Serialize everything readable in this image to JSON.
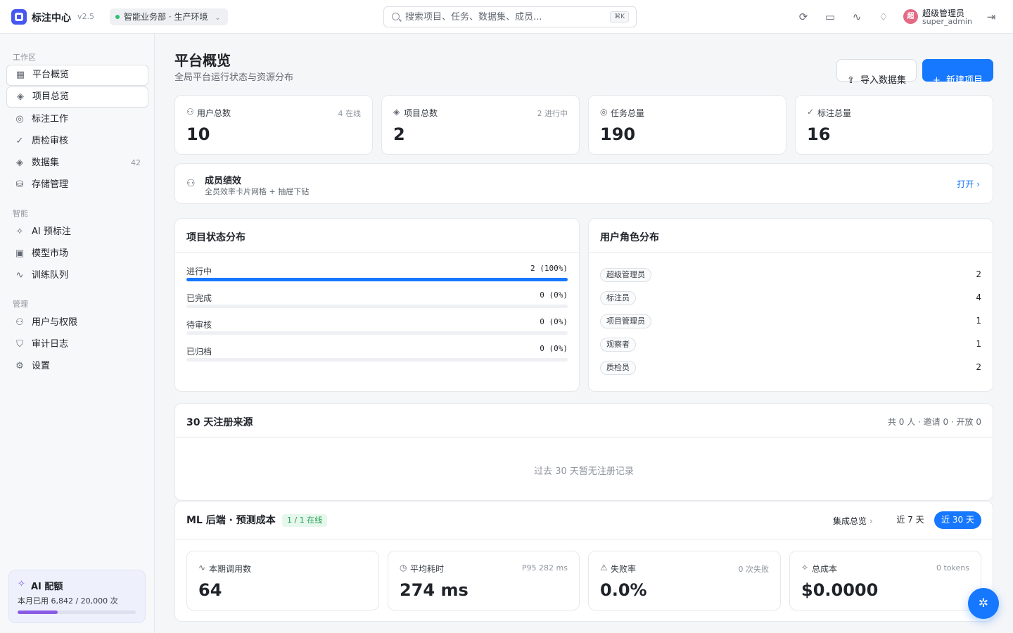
{
  "header": {
    "app_title": "标注中心",
    "version": "v2.5",
    "env": "智能业务部 · 生产环境",
    "search_placeholder": "搜索项目、任务、数据集、成员...",
    "search_shortcut": "⌘K",
    "user_avatar": "超",
    "user_name": "超级管理员",
    "user_handle": "super_admin",
    "icons": [
      "refresh-icon",
      "monitor-icon",
      "activity-icon",
      "bell-icon",
      "logout-icon"
    ]
  },
  "sidebar": {
    "sections": [
      "工作区",
      "智能",
      "管理"
    ],
    "items": [
      {
        "label": "平台概览",
        "icon": "grid-icon",
        "count": ""
      },
      {
        "label": "项目总览",
        "icon": "layers-icon",
        "count": ""
      },
      {
        "label": "标注工作",
        "icon": "target-icon",
        "count": ""
      },
      {
        "label": "质检审核",
        "icon": "check-icon",
        "count": ""
      },
      {
        "label": "数据集",
        "icon": "stack-icon",
        "count": "42"
      },
      {
        "label": "存储管理",
        "icon": "database-icon",
        "count": ""
      },
      {
        "label": "AI 预标注",
        "icon": "sparkle-icon",
        "count": ""
      },
      {
        "label": "模型市场",
        "icon": "robot-icon",
        "count": ""
      },
      {
        "label": "训练队列",
        "icon": "pulse-icon",
        "count": ""
      },
      {
        "label": "用户与权限",
        "icon": "users-icon",
        "count": ""
      },
      {
        "label": "审计日志",
        "icon": "shield-icon",
        "count": ""
      },
      {
        "label": "设置",
        "icon": "gear-icon",
        "count": ""
      }
    ],
    "quota": {
      "title": "AI 配额",
      "text": "本月已用 6,842 / 20,000 次",
      "used_fraction": 0.342
    }
  },
  "main": {
    "title": "平台概览",
    "subtitle": "全局平台运行状态与资源分布",
    "import_label": "导入数据集",
    "new_label": "新建项目",
    "stats": [
      {
        "label": "用户总数",
        "value": "10",
        "meta": "4 在线",
        "icon": "users-icon"
      },
      {
        "label": "项目总数",
        "value": "2",
        "meta": "2 进行中",
        "icon": "layers-icon"
      },
      {
        "label": "任务总量",
        "value": "190",
        "meta": "",
        "icon": "target-icon"
      },
      {
        "label": "标注总量",
        "value": "16",
        "meta": "",
        "icon": "check-icon"
      }
    ],
    "performance": {
      "title": "成员绩效",
      "subtitle": "全员效率卡片网格 + 抽屉下钻",
      "open": "打开"
    },
    "project_status": {
      "title": "项目状态分布",
      "rows": [
        {
          "label": "进行中",
          "value": "2 (100%)",
          "fraction": 1.0
        },
        {
          "label": "已完成",
          "value": "0 (0%)",
          "fraction": 0
        },
        {
          "label": "待审核",
          "value": "0 (0%)",
          "fraction": 0
        },
        {
          "label": "已归档",
          "value": "0 (0%)",
          "fraction": 0
        }
      ]
    },
    "roles": {
      "title": "用户角色分布",
      "rows": [
        {
          "label": "超级管理员",
          "count": "2"
        },
        {
          "label": "标注员",
          "count": "4"
        },
        {
          "label": "项目管理员",
          "count": "1"
        },
        {
          "label": "观察者",
          "count": "1"
        },
        {
          "label": "质检员",
          "count": "2"
        }
      ]
    },
    "registration": {
      "title": "30 天注册来源",
      "meta": "共 0 人 · 邀请 0 · 开放 0",
      "empty": "过去 30 天暂无注册记录"
    },
    "ml": {
      "title": "ML 后端 · 预测成本",
      "badge": "1 / 1 在线",
      "overview": "集成总览",
      "range_7": "近 7 天",
      "range_30": "近 30 天",
      "metrics": [
        {
          "label": "本期调用数",
          "value": "64",
          "meta": "",
          "icon": "activity-icon"
        },
        {
          "label": "平均耗时",
          "value": "274 ms",
          "meta": "P95 282 ms",
          "icon": "clock-icon"
        },
        {
          "label": "失败率",
          "value": "0.0%",
          "meta": "0 次失败",
          "icon": "warning-icon"
        },
        {
          "label": "总成本",
          "value": "$0.0000",
          "meta": "0 tokens",
          "icon": "sparkle-icon"
        }
      ]
    }
  },
  "colors": {
    "primary": "#1677ff",
    "brand": "#4457f0",
    "success": "#1f9d55",
    "quota": "#8a5ce6"
  }
}
